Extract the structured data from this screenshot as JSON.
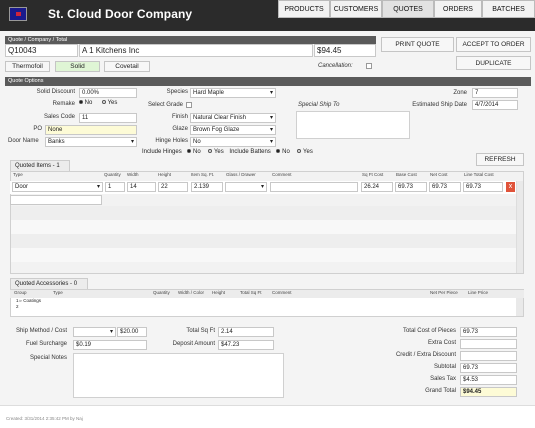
{
  "brand": "St. Cloud Door Company",
  "nav": [
    "PRODUCTS",
    "CUSTOMERS",
    "QUOTES",
    "ORDERS",
    "BATCHES"
  ],
  "header": {
    "section_label": "Quote / Company / Total",
    "quote_no": "Q10043",
    "company": "A 1 Kitchens Inc",
    "total": "$94.45"
  },
  "actions": {
    "print": "PRINT QUOTE",
    "accept": "ACCEPT TO ORDER",
    "duplicate": "DUPLICATE"
  },
  "door_tabs": [
    "Thermofoil",
    "Solid",
    "Covetail"
  ],
  "cancellation": "Cancellation:",
  "options": {
    "header": "Quote Options",
    "solid_discount_label": "Solid Discount",
    "solid_discount": "0.00%",
    "remake_label": "Remake",
    "no": "No",
    "yes": "Yes",
    "sales_code_label": "Sales Code",
    "sales_code": "11",
    "po_label": "PO",
    "po": "None",
    "door_name_label": "Door Name",
    "door_name": "Banks",
    "species_label": "Species",
    "species": "Hard Maple",
    "select_grade_label": "Select Grade",
    "finish_label": "Finish",
    "finish": "Natural Clear Finish",
    "glaze_label": "Glaze",
    "glaze": "Brown Fog Glaze",
    "hinge_holes_label": "Hinge Holes",
    "hinge_holes": "No",
    "include_hinges_label": "Include Hinges",
    "include_battens_label": "Include Battens",
    "special_ship_to": "Special Ship To",
    "zone_label": "Zone",
    "zone": "7",
    "ship_date_label": "Estimated Ship Date",
    "ship_date": "4/7/2014"
  },
  "items": {
    "header": "Quoted Items - 1",
    "refresh": "REFRESH",
    "columns": [
      "Type",
      "Quantity",
      "Width",
      "Height",
      "Item Sq. Ft.",
      "Glass / Drawer",
      "Comment",
      "Sq Ft Cost",
      "Base Cost",
      "Net Cost",
      "Line Total Cost"
    ],
    "row": {
      "type": "Door",
      "qty": "1",
      "width": "14",
      "height": "22",
      "sqft": "2.139",
      "sqft_cost": "26.24",
      "base_cost": "69.73",
      "net_cost": "69.73",
      "line_total": "69.73"
    },
    "delete": "x"
  },
  "accessories": {
    "header": "Quoted Accessories - 0",
    "columns": [
      "Group",
      "Type",
      "Quantity",
      "Width / Color",
      "Height",
      "Total Sq Ft",
      "Comment",
      "Net Per Piece",
      "Line Price"
    ],
    "tree": [
      "Coatings",
      "2"
    ]
  },
  "footer": {
    "ship_label": "Ship Method / Cost",
    "ship_cost": "$20.00",
    "fuel_label": "Fuel Surcharge",
    "fuel": "$0.19",
    "notes_label": "Special Notes",
    "sqft_label": "Total Sq Ft",
    "sqft": "2.14",
    "deposit_label": "Deposit Amount",
    "deposit": "$47.23",
    "pieces_label": "Total Cost of Pieces",
    "pieces": "69.73",
    "extra_label": "Extra Cost",
    "credit_label": "Credit / Extra Discount",
    "subtotal_label": "Subtotal",
    "subtotal": "69.73",
    "tax_label": "Sales Tax",
    "tax": "$4.53",
    "grand_label": "Grand Total",
    "grand": "$94.45"
  },
  "created": "Created: 3/31/2014 2:35:42 PM by Naj"
}
